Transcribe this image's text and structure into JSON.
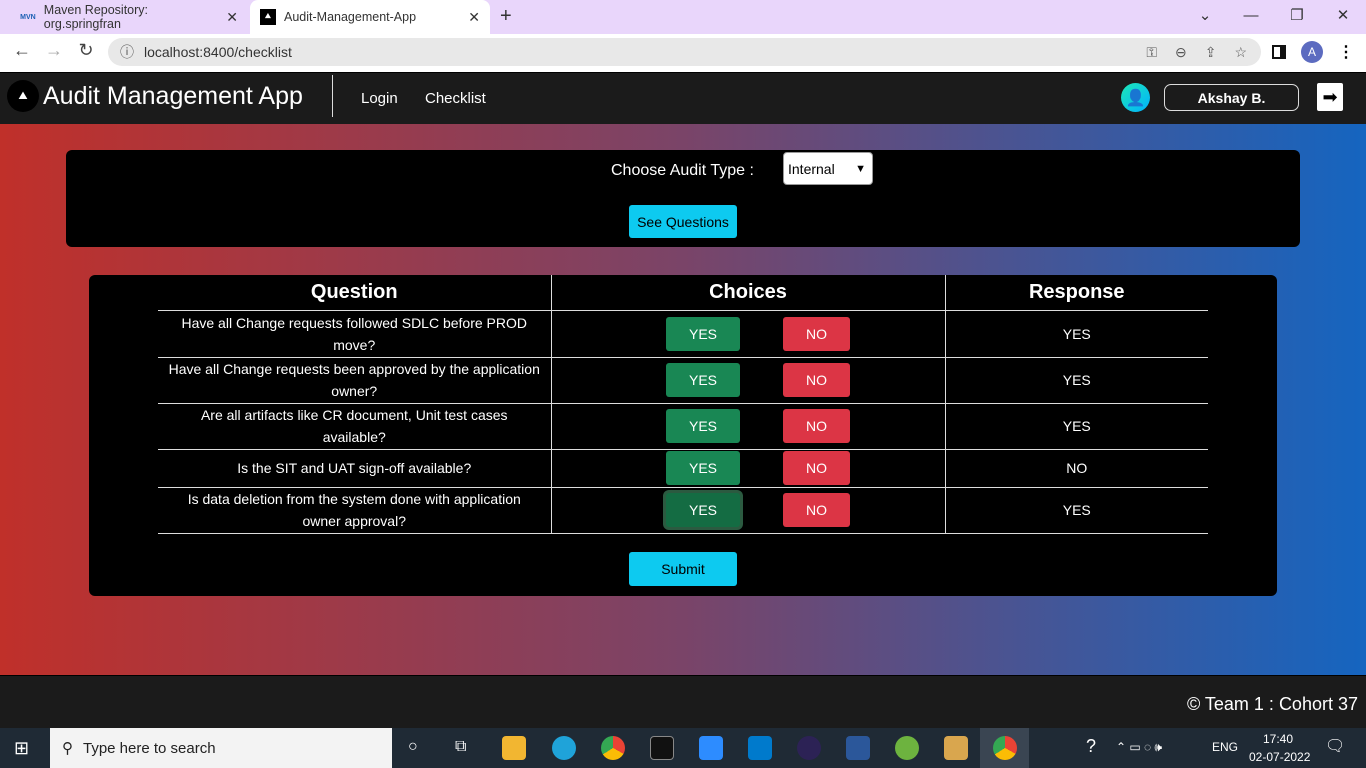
{
  "browser": {
    "tabs": [
      {
        "label": "Maven Repository: org.springfran",
        "icon": "MVN"
      },
      {
        "label": "Audit-Management-App",
        "icon": "logo"
      }
    ],
    "new_tab": "+",
    "url": "localhost:8400/checklist",
    "profile": "A"
  },
  "app": {
    "title": "Audit Management App",
    "nav": [
      "Login",
      "Checklist"
    ],
    "user": "Akshay B."
  },
  "audit": {
    "label": "Choose Audit Type :",
    "selected": "Internal",
    "button": "See Questions"
  },
  "table": {
    "headers": [
      "Question",
      "Choices",
      "Response"
    ],
    "yes_label": "YES",
    "no_label": "NO",
    "rows": [
      {
        "question": "Have all Change requests followed SDLC before PROD move?",
        "response": "YES"
      },
      {
        "question": "Have all Change requests been approved by the application owner?",
        "response": "YES"
      },
      {
        "question": "Are all artifacts like CR document, Unit test cases available?",
        "response": "YES"
      },
      {
        "question": "Is the SIT and UAT sign-off available?",
        "response": "NO"
      },
      {
        "question": "Is data deletion from the system done with application owner approval?",
        "response": "YES"
      }
    ]
  },
  "submit": "Submit",
  "footer": "© Team 1 : Cohort 37",
  "taskbar": {
    "search_placeholder": "Type here to search",
    "lang": "ENG",
    "time": "17:40",
    "date": "02-07-2022"
  }
}
